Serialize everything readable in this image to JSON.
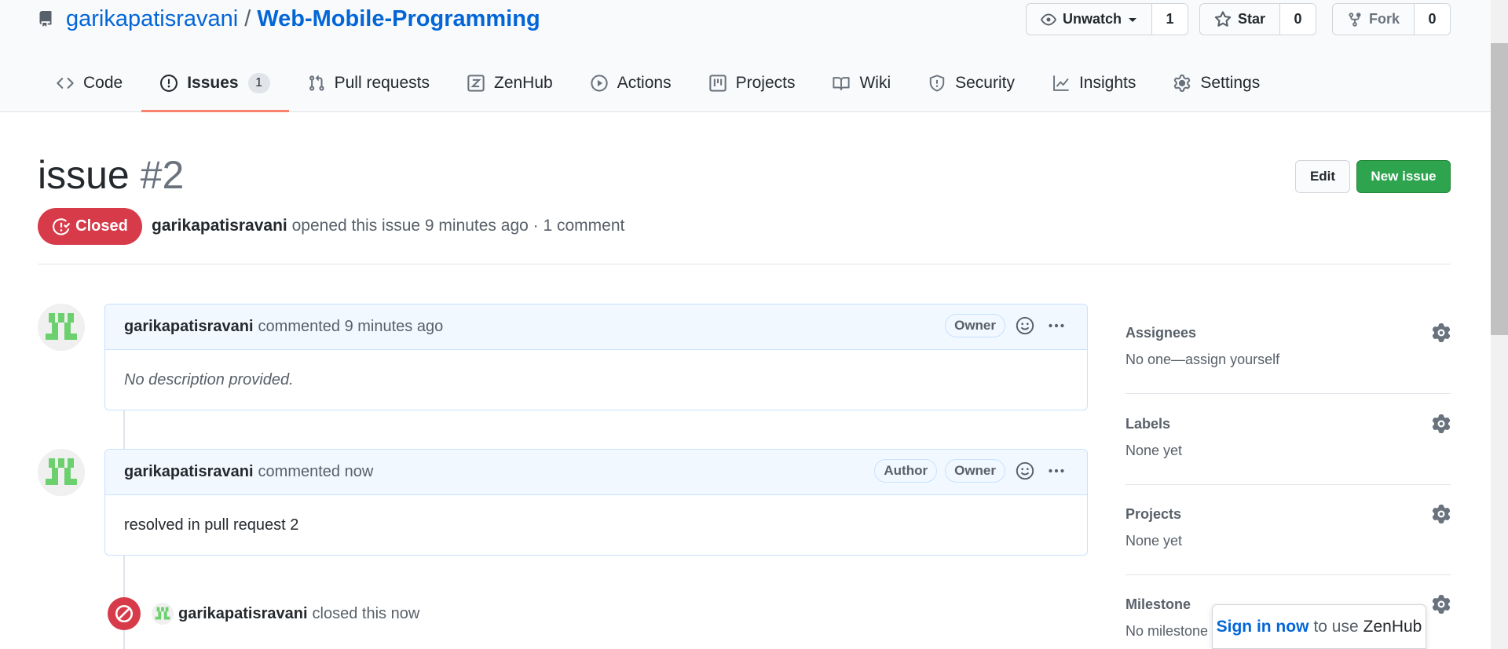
{
  "repo": {
    "owner": "garikapatisravani",
    "separator": "/",
    "name": "Web-Mobile-Programming"
  },
  "actions": {
    "watch_label": "Unwatch",
    "watch_count": "1",
    "star_label": "Star",
    "star_count": "0",
    "fork_label": "Fork",
    "fork_count": "0"
  },
  "tabs": [
    {
      "label": "Code",
      "icon": "code-icon"
    },
    {
      "label": "Issues",
      "icon": "issue-icon",
      "badge": "1",
      "selected": true
    },
    {
      "label": "Pull requests",
      "icon": "pull-request-icon"
    },
    {
      "label": "ZenHub",
      "icon": "zenhub-icon"
    },
    {
      "label": "Actions",
      "icon": "play-icon"
    },
    {
      "label": "Projects",
      "icon": "project-icon"
    },
    {
      "label": "Wiki",
      "icon": "book-icon"
    },
    {
      "label": "Security",
      "icon": "shield-icon"
    },
    {
      "label": "Insights",
      "icon": "graph-icon"
    },
    {
      "label": "Settings",
      "icon": "gear-icon"
    }
  ],
  "issue": {
    "title": "issue",
    "number": "#2",
    "state": "Closed",
    "author": "garikapatisravani",
    "meta_text": "opened this issue 9 minutes ago · 1 comment",
    "edit_label": "Edit",
    "new_issue_label": "New issue"
  },
  "comments": [
    {
      "author": "garikapatisravani",
      "time": "commented 9 minutes ago",
      "labels": [
        "Owner"
      ],
      "body": "No description provided."
    },
    {
      "author": "garikapatisravani",
      "time": "commented now",
      "labels": [
        "Author",
        "Owner"
      ],
      "body": "resolved in pull request 2"
    }
  ],
  "closed_event": {
    "actor": "garikapatisravani",
    "text": "closed this now"
  },
  "sidebar": {
    "assignees": {
      "title": "Assignees",
      "value": "No one—assign yourself"
    },
    "labels": {
      "title": "Labels",
      "value": "None yet"
    },
    "projects": {
      "title": "Projects",
      "value": "None yet"
    },
    "milestone": {
      "title": "Milestone",
      "value": "No milestone"
    }
  },
  "zenhub_popup": {
    "link": "Sign in now",
    "text": "to use",
    "brand": "ZenHub"
  },
  "colors": {
    "link": "#0366d6",
    "closed": "#d73a49",
    "success": "#2ea44f",
    "tab_underline": "#f9826c"
  }
}
